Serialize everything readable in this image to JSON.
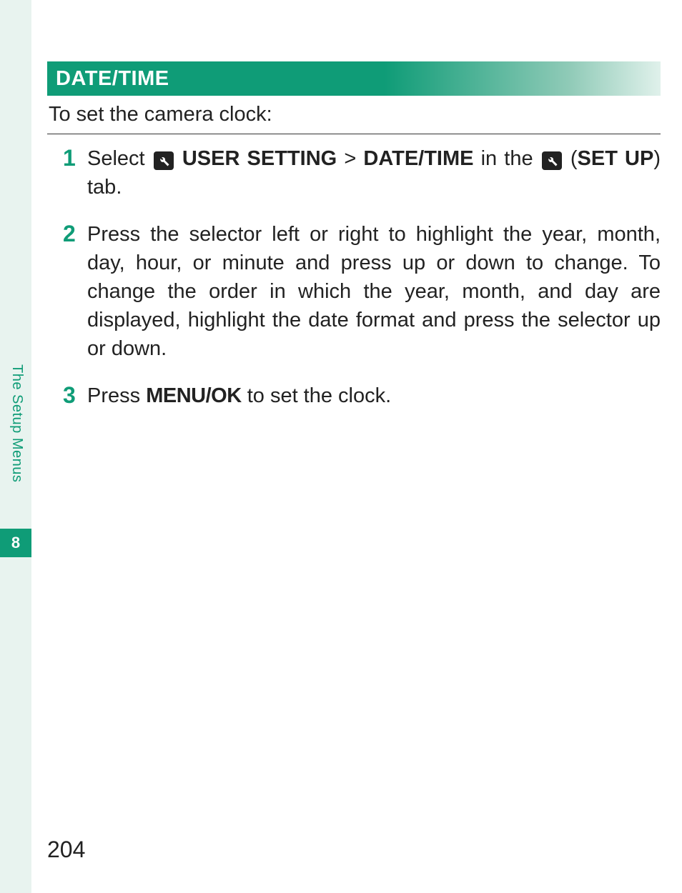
{
  "sidebar": {
    "chapter_label": "The Setup Menus",
    "chapter_number": "8"
  },
  "section": {
    "header": "DATE/TIME",
    "intro": "To set the camera clock:"
  },
  "steps": [
    {
      "num": "1",
      "text_pre": "Select ",
      "bold_a": "USER SETTING",
      "sep": " > ",
      "bold_b": "DATE/TIME",
      "mid": " in the ",
      "paren_open": "(",
      "bold_c": "SET UP",
      "text_post": ") tab."
    },
    {
      "num": "2",
      "text": "Press the selector left or right to highlight the year, month, day, hour, or minute and press up or down to change. To change the order in which the year, month, and day are displayed, high­light the date format and press the selector up or down."
    },
    {
      "num": "3",
      "text_pre": "Press ",
      "bold_a": "MENU/OK",
      "text_post": " to set the clock."
    }
  ],
  "page_number": "204"
}
